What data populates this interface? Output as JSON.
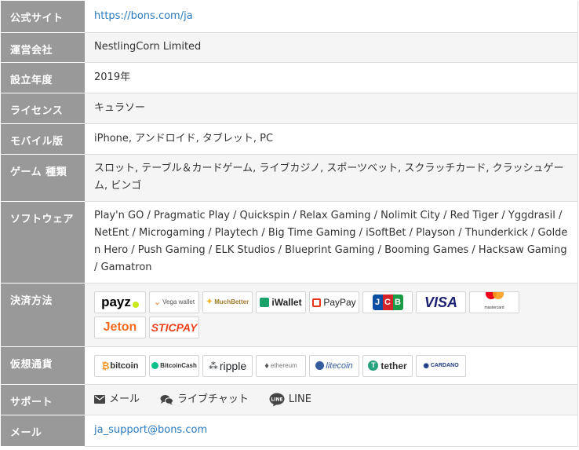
{
  "rows": {
    "site": {
      "label": "公式サイト",
      "value": "https://bons.com/ja"
    },
    "company": {
      "label": "運営会社",
      "value": "NestlingCorn Limited"
    },
    "founded": {
      "label": "設立年度",
      "value": "2019年"
    },
    "license": {
      "label": "ライセンス",
      "value": "キュラソー"
    },
    "mobile": {
      "label": "モバイル版",
      "value": "iPhone, アンドロイド, タブレット, PC"
    },
    "games": {
      "label": "ゲーム 種類",
      "value": "スロット, テーブル＆カードゲーム, ライブカジノ, スポーツベット, スクラッチカード, クラッシュゲーム, ビンゴ"
    },
    "software": {
      "label": "ソフトウェア",
      "value": "Play'n GO / Pragmatic Play / Quickspin / Relax Gaming / Nolimit City / Red Tiger / Yggdrasil / NetEnt / Microgaming / Playtech / Big Time Gaming / iSoftBet / Playson / Thunderkick / Golden Hero / Push Gaming / ELK Studios / Blueprint Gaming / Booming Games / Hacksaw Gaming / Gamatron"
    },
    "payment": {
      "label": "決済方法",
      "logos": [
        {
          "text": "payz",
          "color": "#000000"
        },
        {
          "text": "Vega wallet",
          "color": "#555555"
        },
        {
          "text": "MuchBetter",
          "color": "#a07a2a"
        },
        {
          "text": "iWallet",
          "color": "#222222"
        },
        {
          "text": "PayPay",
          "color": "#222222"
        },
        {
          "text": "JCB",
          "color": "#ffffff"
        },
        {
          "text": "VISA",
          "color": "#1a1f71"
        },
        {
          "text": "mastercard",
          "color": "#333333"
        },
        {
          "text": "Jeton",
          "color": "#f26b21"
        },
        {
          "text": "STICPAY",
          "color": "#e8431c"
        }
      ]
    },
    "crypto": {
      "label": "仮想通貨",
      "logos": [
        {
          "text": "bitcoin",
          "color": "#333333"
        },
        {
          "text": "BitcoinCash",
          "color": "#333333"
        },
        {
          "text": "ripple",
          "color": "#23292f"
        },
        {
          "text": "ethereum",
          "color": "#777777"
        },
        {
          "text": "litecoin",
          "color": "#345d9d"
        },
        {
          "text": "tether",
          "color": "#333333"
        },
        {
          "text": "CARDANO",
          "color": "#1d3b85"
        }
      ]
    },
    "support": {
      "label": "サポート",
      "items": [
        {
          "text": "メール"
        },
        {
          "text": "ライブチャット"
        },
        {
          "text": "LINE"
        }
      ]
    },
    "email": {
      "label": "メール",
      "value": "ja_support@bons.com"
    }
  },
  "colors": {
    "header_bg": "#999999",
    "link": "#2b7bbf",
    "payz_dot": "#c9e81c",
    "bitcoin_orange": "#f7931a",
    "bch_green": "#0ac18e",
    "tether_green": "#26a17b",
    "mastercard_red": "#eb001b",
    "mastercard_orange": "#f79e1b"
  },
  "icons": {
    "mail": "envelope-icon",
    "chat": "comments-icon",
    "line": "line-app-icon"
  }
}
